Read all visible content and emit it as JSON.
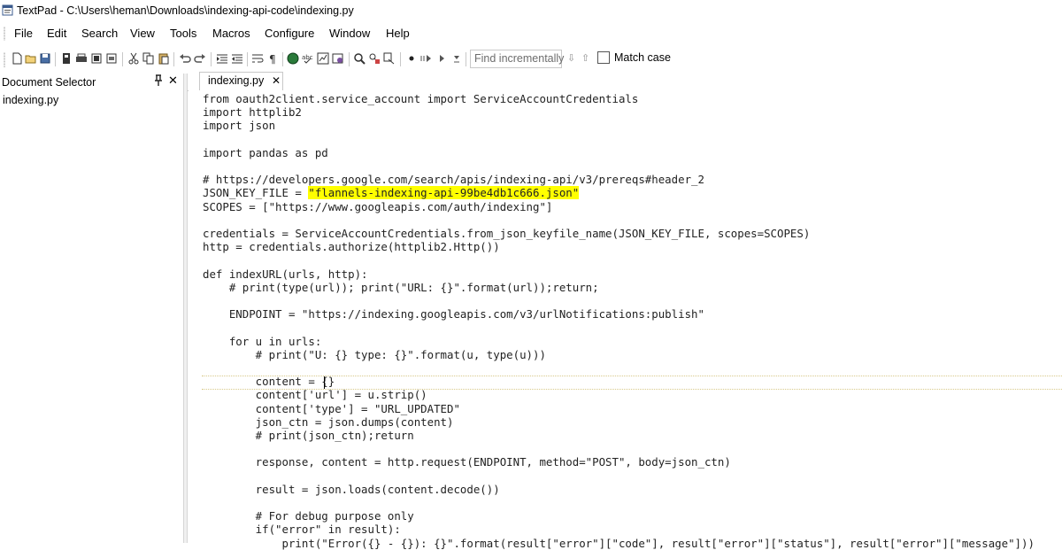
{
  "titlebar": {
    "title": "TextPad - C:\\Users\\heman\\Downloads\\indexing-api-code\\indexing.py"
  },
  "menu": {
    "items": [
      "File",
      "Edit",
      "Search",
      "View",
      "Tools",
      "Macros",
      "Configure",
      "Window",
      "Help"
    ]
  },
  "toolbar": {
    "find_placeholder": "Find incrementally",
    "match_case_label": "Match case",
    "match_case_checked": false
  },
  "doc_selector": {
    "title": "Document Selector",
    "pin_glyph": "📌",
    "close_glyph": "✕",
    "items": [
      "indexing.py"
    ]
  },
  "tabs": [
    {
      "label": "indexing.py",
      "close_glyph": "✕",
      "active": true
    }
  ],
  "editor": {
    "current_line_index": 20,
    "highlight": {
      "line_index": 7,
      "before": "JSON_KEY_FILE = ",
      "text": "\"flannels-indexing-api-99be4db1c666.json\""
    },
    "lines": [
      "from oauth2client.service_account import ServiceAccountCredentials",
      "import httplib2",
      "import json",
      "",
      "import pandas as pd",
      "",
      "# https://developers.google.com/search/apis/indexing-api/v3/prereqs#header_2",
      "JSON_KEY_FILE = \"flannels-indexing-api-99be4db1c666.json\"",
      "SCOPES = [\"https://www.googleapis.com/auth/indexing\"]",
      "",
      "credentials = ServiceAccountCredentials.from_json_keyfile_name(JSON_KEY_FILE, scopes=SCOPES)",
      "http = credentials.authorize(httplib2.Http())",
      "",
      "def indexURL(urls, http):",
      "    # print(type(url)); print(\"URL: {}\".format(url));return;",
      "",
      "    ENDPOINT = \"https://indexing.googleapis.com/v3/urlNotifications:publish\"",
      "",
      "    for u in urls:",
      "        # print(\"U: {} type: {}\".format(u, type(u)))",
      "",
      "        content = {}",
      "        content['url'] = u.strip()",
      "        content['type'] = \"URL_UPDATED\"",
      "        json_ctn = json.dumps(content)",
      "        # print(json_ctn);return",
      "",
      "        response, content = http.request(ENDPOINT, method=\"POST\", body=json_ctn)",
      "",
      "        result = json.loads(content.decode())",
      "",
      "        # For debug purpose only",
      "        if(\"error\" in result):",
      "            print(\"Error({} - {}): {}\".format(result[\"error\"][\"code\"], result[\"error\"][\"status\"], result[\"error\"][\"message\"]))"
    ]
  }
}
